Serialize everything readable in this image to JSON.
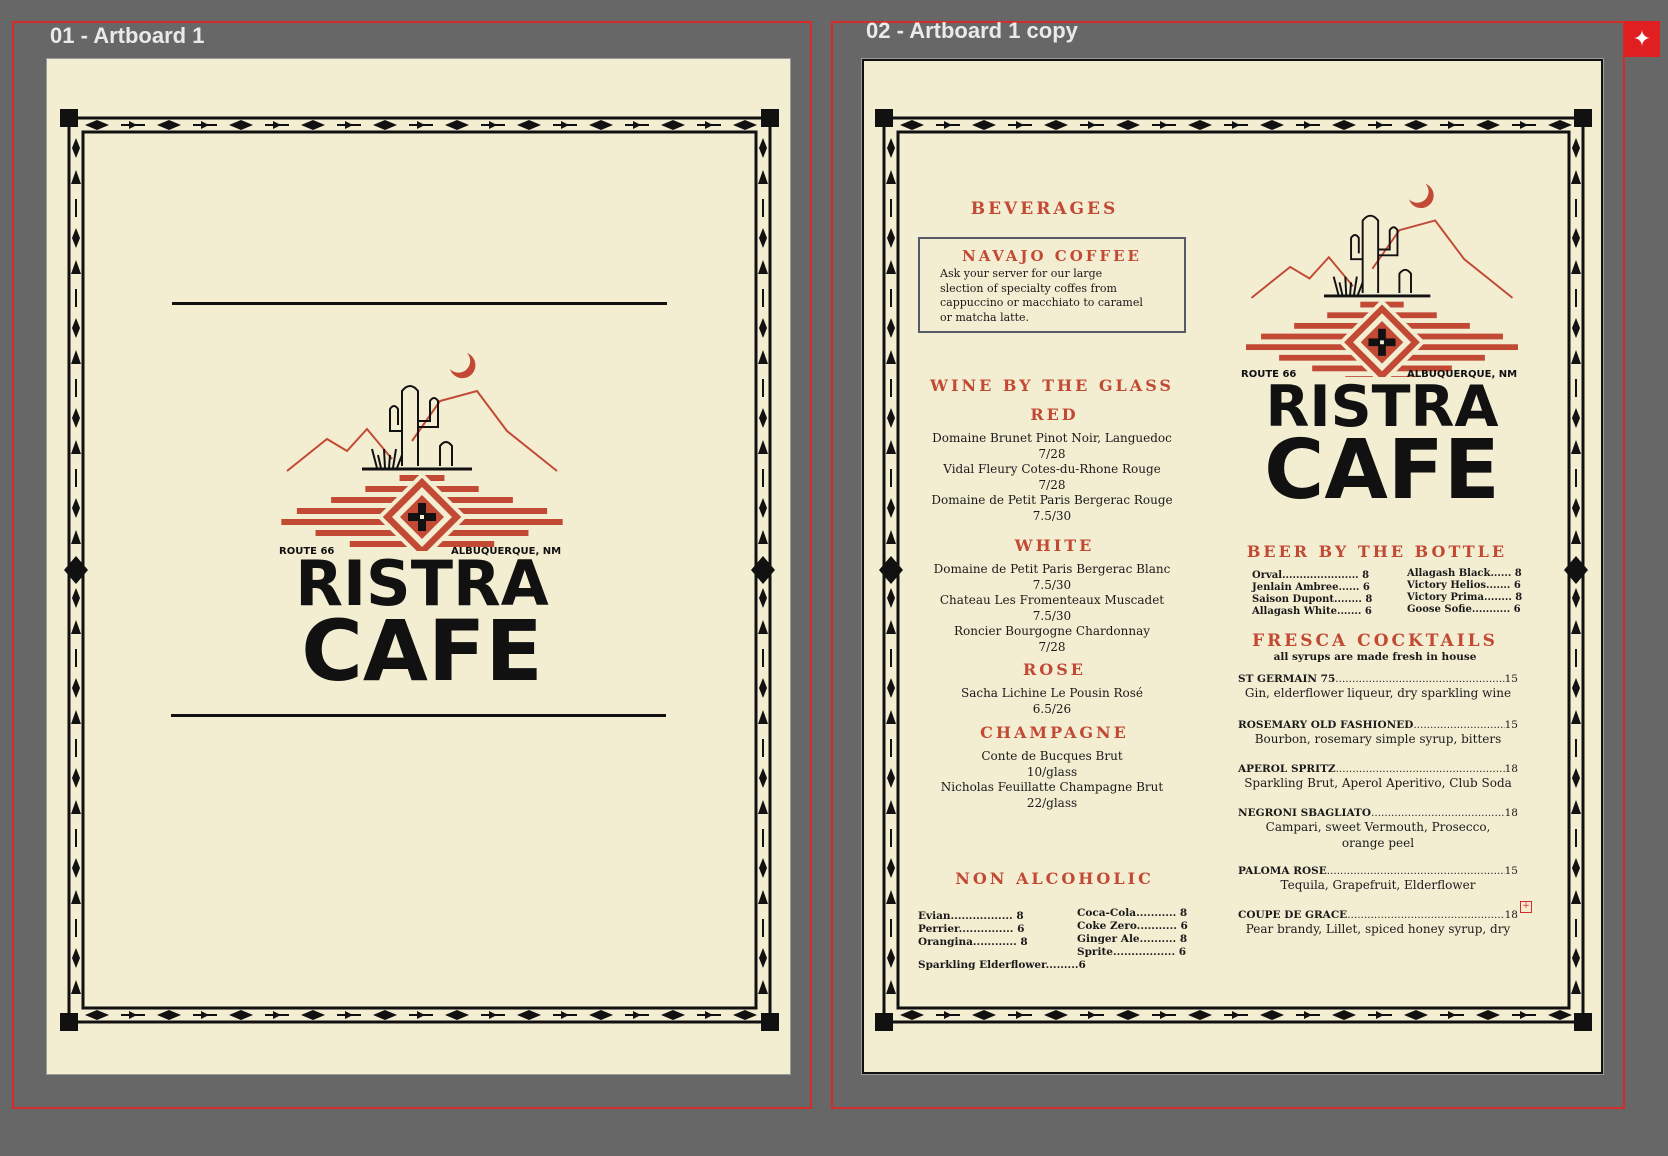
{
  "artboards": {
    "first": {
      "label": "01 - Artboard 1"
    },
    "second": {
      "label": "02 - Artboard 1 copy"
    }
  },
  "colors": {
    "accent": "#c24a35",
    "ink": "#111111",
    "paper": "#f3edd2",
    "canvas": "#676767",
    "selection": "#d62b2b"
  },
  "logo": {
    "route": "ROUTE 66",
    "city": "ALBUQUERQUE, NM",
    "line1": "RISTRA",
    "line2": "CAFE"
  },
  "beverages": {
    "title": "BEVERAGES",
    "coffee_title": "NAVAJO COFFEE",
    "coffee_desc": [
      "Ask your server for our large",
      "slection of specialty coffes from",
      "cappuccino or macchiato to caramel",
      "or matcha latte."
    ]
  },
  "wine": {
    "title": "WINE BY THE GLASS",
    "red_title": "RED",
    "red": [
      [
        "Domaine Brunet Pinot Noir, Languedoc",
        "7/28"
      ],
      [
        "Vidal Fleury Cotes-du-Rhone Rouge",
        "7/28"
      ],
      [
        "Domaine de Petit Paris Bergerac Rouge",
        "7.5/30"
      ]
    ],
    "white_title": "WHITE",
    "white": [
      [
        "Domaine de Petit Paris Bergerac Blanc",
        "7.5/30"
      ],
      [
        "Chateau Les Fromenteaux Muscadet",
        "7.5/30"
      ],
      [
        "Roncier Bourgogne Chardonnay",
        "7/28"
      ]
    ],
    "rose_title": "ROSE",
    "rose": [
      [
        "Sacha Lichine Le Pousin Rosé",
        "6.5/26"
      ]
    ],
    "champagne_title": "CHAMPAGNE",
    "champagne": [
      [
        "Conte de Bucques Brut",
        "10/glass"
      ],
      [
        "Nicholas Feuillatte Champagne Brut",
        "22/glass"
      ]
    ]
  },
  "non_alcoholic": {
    "title": "NON ALCOHOLIC",
    "left": [
      "Evian................. 8",
      "Perrier............... 6",
      "Orangina............ 8"
    ],
    "right": [
      "Coca-Cola........... 8",
      "Coke Zero........... 6",
      "Ginger Ale.......... 8",
      "Sprite................. 6"
    ],
    "bottom": "Sparkling Elderflower.........6"
  },
  "beer": {
    "title": "BEER BY THE BOTTLE",
    "left": [
      "Orval...................... 8",
      "Jenlain Ambree...... 6",
      "Saison Dupont........ 8",
      "Allagash White....... 6"
    ],
    "right": [
      "Allagash Black...... 8",
      "Victory Helios....... 6",
      "Victory Prima........ 8",
      "Goose Sofie........... 6"
    ]
  },
  "cocktails": {
    "title": "FRESCA COCKTAILS",
    "subtitle": "all syrups are made fresh in house",
    "items": [
      {
        "name": "ST GERMAIN 75",
        "price": "15",
        "desc": "Gin, elderflower liqueur, dry sparkling wine"
      },
      {
        "name": "ROSEMARY OLD FASHIONED",
        "price": "15",
        "desc": "Bourbon, rosemary simple syrup, bitters"
      },
      {
        "name": "APEROL SPRITZ",
        "price": "18",
        "desc": "Sparkling Brut, Aperol Aperitivo, Club Soda"
      },
      {
        "name": "NEGRONI SBAGLIATO",
        "price": "18",
        "desc": "Campari, sweet Vermouth, Prosecco, orange peel"
      },
      {
        "name": "PALOMA ROSE",
        "price": "15",
        "desc": "Tequila, Grapefruit, Elderflower"
      },
      {
        "name": "COUPE DE GRACE",
        "price": "18",
        "desc": "Pear brandy, Lillet, spiced honey syrup, dry"
      }
    ]
  },
  "icons": {
    "pin": "pin-icon",
    "overflow": "text-overflow-icon"
  }
}
